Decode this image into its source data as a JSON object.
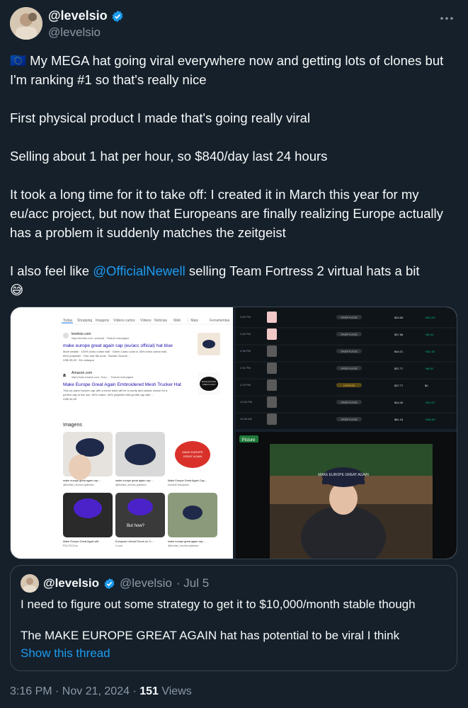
{
  "author": {
    "name": "@levelsio",
    "handle": "@levelsio",
    "verified_icon": "verified-badge-icon"
  },
  "more_icon": "more-dots-icon",
  "tweet": {
    "lines": [
      "🇪🇺 My MEGA hat going viral everywhere now and getting lots of clones but I'm ranking #1 so that's really nice",
      "",
      "First physical product I made that's going really viral",
      "",
      "Selling about 1 hat per hour, so $840/day last 24 hours",
      "",
      "It took a long time for it to take off: I created it in March this year for my eu/acc project, but now that Europeans are finally realizing Europe actually has a problem it suddenly matches the zeitgeist",
      ""
    ],
    "last_line_prefix": "I also feel like ",
    "mention": "@OfficialNewell",
    "last_line_suffix": " selling Team Fortress 2 virtual hats a bit",
    "emoji": "😅"
  },
  "media": {
    "search": {
      "tabs": [
        "Todas",
        "Shopping",
        "Imagens",
        "Vídeos curtos",
        "Vídeos",
        "Notícias",
        "Web",
        "⋮ Mais",
        "Ferramentas"
      ],
      "results": [
        {
          "site": "levelsio.com",
          "url": "https://levelsio.com › products · Traduzir esta página",
          "title": "make europe great again cap (eu/acc official) hat blue",
          "desc1": "More details · 100% chino cotton twill · Green Camo color is 35% chino cotton twill,",
          "desc2": "65% polyester · One size fits most · Buckle Closure ...",
          "price": "US$ 35,00 · Em estoque"
        },
        {
          "site": "Amazon.com",
          "url": "https://www.amazon.com › Sorp... · Traduzir esta página",
          "title": "Make Europe Great Again Embroidered Mesh Trucker Hat",
          "desc1": "This six panel trucker cap with a mesh back will be a comfy and classic choice for a",
          "desc2": "perfect day in the sun. 80% cotton, 40% polyester Mid-profile cap with ...",
          "price": "US$ 34,99"
        }
      ],
      "images_heading": "Imagens",
      "image_captions": [
        {
          "title": "make europe great agam cap ...",
          "source": "@levelsio | techno optimism"
        },
        {
          "title": "make europe great agam cap ...",
          "source": "@levelsio | techno optimism"
        },
        {
          "title": "Make Europe Great Again Cap...",
          "source": "Dominik Teiczyński"
        },
        {
          "title": "Make Europe Great Again will...",
          "source": "POLITICO.eu"
        },
        {
          "title": "European Liberal Forum on X:...",
          "source": "X.com"
        },
        {
          "title": "make europe great agam cap ...",
          "source": "@levelsio | techno optimism"
        }
      ],
      "cap_text": "MAKE EUROPE GREAT AGAIN",
      "but_how": "But how?"
    },
    "orders": [
      {
        "time": "2:50 PM",
        "status": "ORDER PLACED",
        "amount": "$43.65",
        "delta": "+$10.30"
      },
      {
        "time": "2:46 PM",
        "status": "ORDER PLACED",
        "amount": "$37.58",
        "delta": "+$4.04"
      },
      {
        "time": "2:36 PM",
        "status": "ORDER PLACED",
        "amount": "$44.21",
        "delta": "+$11.30"
      },
      {
        "time": "2:31 PM",
        "status": "ORDER PLACED",
        "amount": "$37.77",
        "delta": "+$6.52"
      },
      {
        "time": "2:19 PM",
        "status": "CANCELED",
        "amount": "$37.77",
        "delta": "$0"
      },
      {
        "time": "12:54 PM",
        "status": "ORDER PLACED",
        "amount": "$44.40",
        "delta": "+$14.07"
      },
      {
        "time": "10:46 AM",
        "status": "ORDER PLACED",
        "amount": "$61.15",
        "delta": "+$30.80"
      }
    ],
    "picture_label": "Picture",
    "photo_cap_text": "MAKE EUROPE GREAT AGAIN"
  },
  "quote": {
    "name": "@levelsio",
    "handle": "@levelsio",
    "date": "· Jul 5",
    "line1": "I need to figure out some strategy to get it to $10,000/month stable though",
    "line2": "The MAKE EUROPE GREAT AGAIN hat has potential to be viral I think",
    "show_thread": "Show this thread"
  },
  "footer": {
    "time": "3:16 PM · Nov 21, 2024 · ",
    "views_count": "151",
    "views_label": " Views"
  },
  "colors": {
    "background": "#15202b",
    "text": "#f7f9f9",
    "muted": "#8b98a5",
    "accent": "#1d9bf0",
    "cap_navy": "#1f2a4a",
    "cap_red": "#d9312a",
    "cap_purple": "#4b22c9"
  }
}
